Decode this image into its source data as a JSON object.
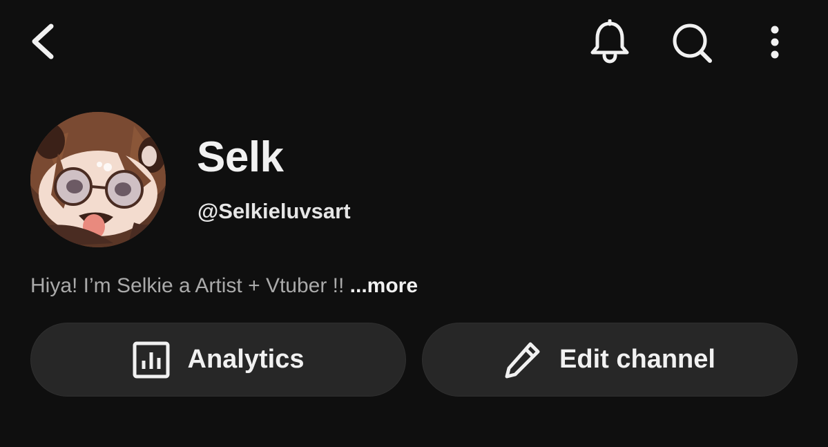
{
  "colors": {
    "background": "#0f0f0f",
    "text_primary": "#f1f1f1",
    "text_secondary": "#aaaaaa",
    "button_bg": "#272727"
  },
  "topbar": {
    "back_icon": "chevron-left-icon",
    "notifications_icon": "bell-icon",
    "search_icon": "search-icon",
    "more_icon": "more-vertical-icon"
  },
  "channel": {
    "name": "Selk",
    "handle": "@Selkieluvsart",
    "bio": "Hiya! I’m Selkie a Artist + Vtuber !! ",
    "bio_more": "...more"
  },
  "actions": {
    "analytics_label": "Analytics",
    "analytics_icon": "analytics-chart-icon",
    "edit_label": "Edit channel",
    "edit_icon": "pencil-icon"
  }
}
